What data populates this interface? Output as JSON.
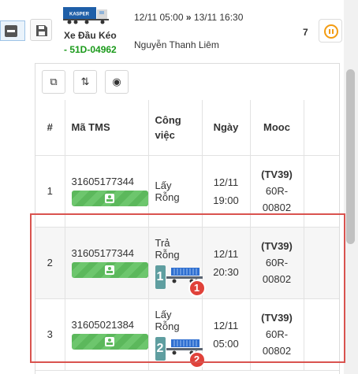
{
  "header": {
    "logo_text": "KASPER",
    "vehicle_type": "Xe Đầu Kéo",
    "plate": "- 51D-04962",
    "time_start": "12/11 05:00",
    "time_sep": "»",
    "time_end": "13/11 16:30",
    "driver": "Nguyễn Thanh Liêm",
    "count": "7"
  },
  "toolbar": {
    "buttons": [
      {
        "name": "open-external",
        "glyph": "⧉"
      },
      {
        "name": "sort",
        "glyph": "⇅"
      },
      {
        "name": "view",
        "glyph": "◉"
      }
    ]
  },
  "table": {
    "headers": {
      "num": "#",
      "tms": "Mã TMS",
      "job": "Công việc",
      "date": "Ngày",
      "mooc": "Mooc"
    },
    "rows": [
      {
        "num": "1",
        "tms": "31605177344",
        "job": "Lấy Rỗng",
        "step": "",
        "badge": "",
        "date": "12/11",
        "time": "19:00",
        "mooc_code": "(TV39)",
        "mooc_plate_1": "60R-",
        "mooc_plate_2": "00802"
      },
      {
        "num": "2",
        "tms": "31605177344",
        "job": "Trả Rỗng",
        "step": "1",
        "badge": "1",
        "date": "12/11",
        "time": "20:30",
        "mooc_code": "(TV39)",
        "mooc_plate_1": "60R-",
        "mooc_plate_2": "00802"
      },
      {
        "num": "3",
        "tms": "31605021384",
        "job": "Lấy Rỗng",
        "step": "2",
        "badge": "2",
        "date": "12/11",
        "time": "05:00",
        "mooc_code": "(TV39)",
        "mooc_plate_1": "60R-",
        "mooc_plate_2": "00802"
      }
    ]
  },
  "colors": {
    "plate": "#1a9a1a",
    "tms_bar": "#5cb85c",
    "pause": "#f39c12",
    "badge": "#e0423a",
    "step": "#5f9ea0",
    "container": "#2f6fd0",
    "highlight": "#d9534f"
  }
}
